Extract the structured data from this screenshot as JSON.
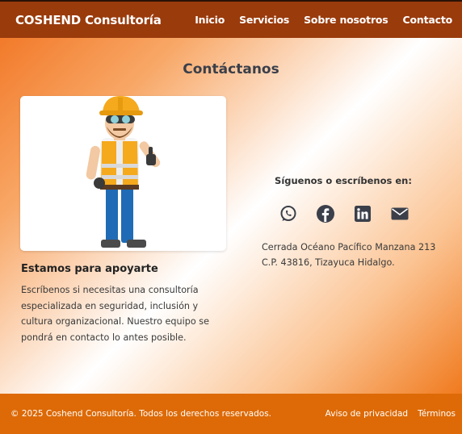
{
  "navbar": {
    "brand": "COSHEND Consultoría",
    "links": [
      "Inicio",
      "Servicios",
      "Sobre nosotros",
      "Contacto"
    ],
    "bg_color": "#9a3b0c"
  },
  "contact": {
    "title": "Contáctanos",
    "image_icon": "construction-worker-illustration",
    "subtitle": "Estamos para apoyarte",
    "description": "Escríbenos si necesitas una consultoría especializada en seguridad, inclusión y cultura organizacional. Nuestro equipo se pondrá en contacto lo antes posible.",
    "social_heading": "Síguenos o escríbenos en:",
    "social_icons": [
      "whatsapp-icon",
      "facebook-icon",
      "linkedin-icon",
      "email-icon"
    ],
    "address_line1": "Cerrada Océano Pacífico Manzana 213",
    "address_line2": "C.P. 43816, Tizayuca Hidalgo."
  },
  "footer": {
    "copyright": "© 2025 Coshend Consultoría. Todos los derechos reservados.",
    "links": [
      "Aviso de privacidad",
      "Términos"
    ],
    "bg_color": "#dd6a06"
  },
  "colors": {
    "icon": "#3a3f4a",
    "accent_orange": "#f27a2a"
  }
}
